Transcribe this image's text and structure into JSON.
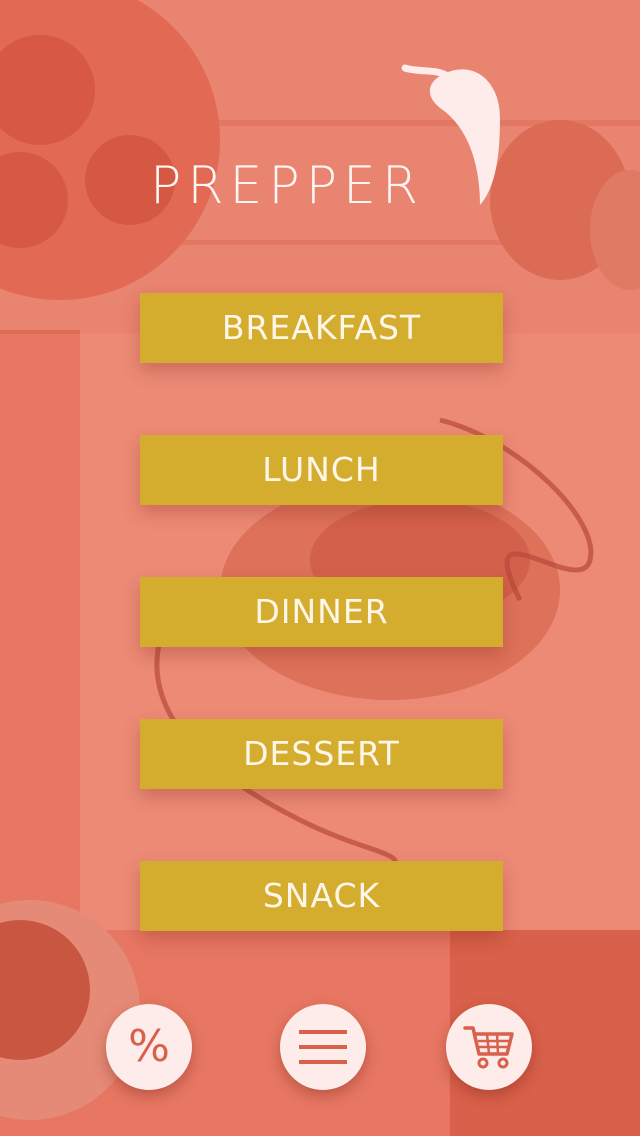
{
  "app": {
    "title": "PREPPER",
    "logo_icon": "chili-pepper-icon"
  },
  "colors": {
    "overlay": "#e8735f",
    "button_bg": "#d4ad2f",
    "button_text": "#fff6ea",
    "round_button_bg": "#fdecea",
    "icon_accent": "#d9604a"
  },
  "menu": {
    "items": [
      {
        "label": "BREAKFAST"
      },
      {
        "label": "LUNCH"
      },
      {
        "label": "DINNER"
      },
      {
        "label": "DESSERT"
      },
      {
        "label": "SNACK"
      }
    ]
  },
  "bottom_bar": {
    "discount": {
      "icon": "percent-icon",
      "glyph": "%"
    },
    "menu": {
      "icon": "hamburger-menu-icon"
    },
    "cart": {
      "icon": "shopping-cart-icon"
    }
  }
}
